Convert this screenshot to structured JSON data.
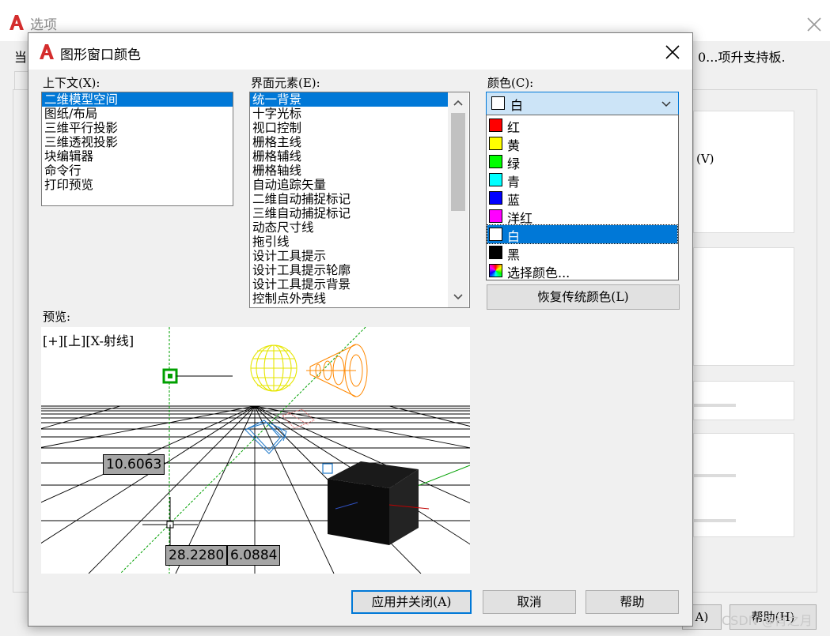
{
  "background_window": {
    "title": "选项",
    "partial_left_text": "当",
    "partial_right_text": "0...项升支持板.",
    "v_label": "(V)",
    "btn_partial_a": "A)",
    "btn_help": "帮助(H)",
    "watermark": "CSDN @肖之月"
  },
  "dialog": {
    "title": "图形窗口颜色",
    "context": {
      "label": "上下文(X):",
      "items": [
        "二维模型空间",
        "图纸/布局",
        "三维平行投影",
        "三维透视投影",
        "块编辑器",
        "命令行",
        "打印预览"
      ],
      "selected_index": 0
    },
    "interface_elements": {
      "label": "界面元素(E):",
      "items": [
        "统一背景",
        "十字光标",
        "视口控制",
        "栅格主线",
        "栅格辅线",
        "栅格轴线",
        "自动追踪矢量",
        "二维自动捕捉标记",
        "三维自动捕捉标记",
        "动态尺寸线",
        "拖引线",
        "设计工具提示",
        "设计工具提示轮廓",
        "设计工具提示背景",
        "控制点外壳线"
      ],
      "selected_index": 0
    },
    "color": {
      "label": "颜色(C):",
      "current": "白",
      "options": [
        {
          "name": "红",
          "color": "#ff0000"
        },
        {
          "name": "黄",
          "color": "#ffff00"
        },
        {
          "name": "绿",
          "color": "#00ff00"
        },
        {
          "name": "青",
          "color": "#00ffff"
        },
        {
          "name": "蓝",
          "color": "#0000ff"
        },
        {
          "name": "洋红",
          "color": "#ff00ff"
        },
        {
          "name": "白",
          "color": "#ffffff"
        },
        {
          "name": "黑",
          "color": "#000000"
        },
        {
          "name": "选择颜色...",
          "color": "multicolor"
        }
      ],
      "highlighted_index": 6
    },
    "restore_button": "恢复传统颜色(L)",
    "preview": {
      "label": "预览:",
      "viewport_caption": "[+][上][X-射线]",
      "dim_values": [
        "10.6063",
        "28.2280",
        "6.0884"
      ]
    },
    "buttons": {
      "apply_close": "应用并关闭(A)",
      "cancel": "取消",
      "help": "帮助"
    }
  }
}
